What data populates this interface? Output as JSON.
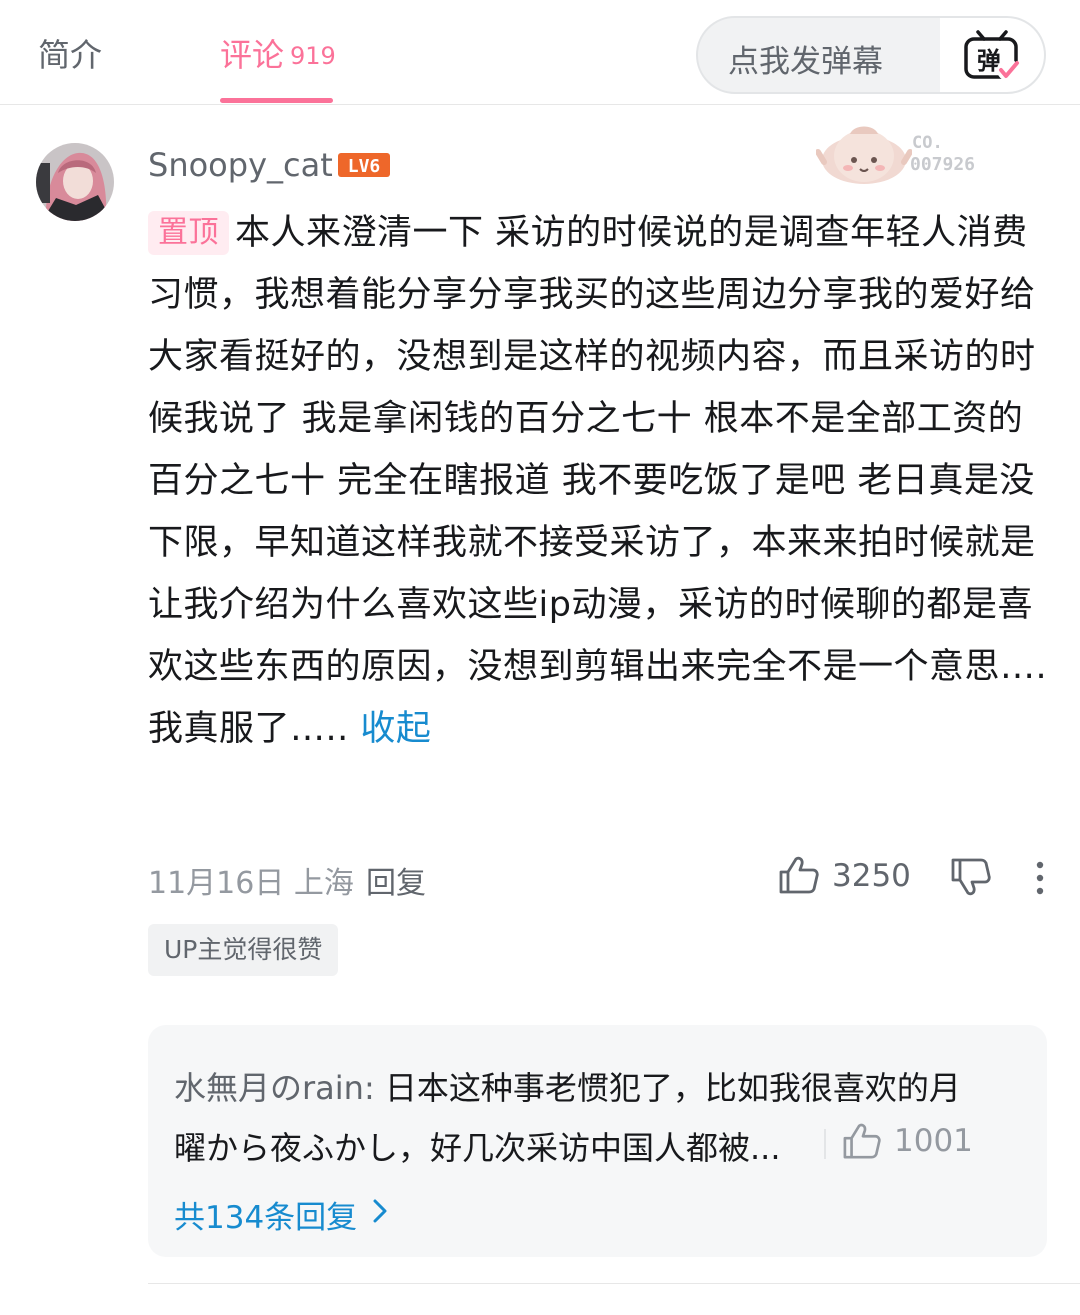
{
  "header": {
    "tab_intro": "简介",
    "tab_comments": "评论",
    "comment_count": "919",
    "danmaku_placeholder": "点我发弹幕",
    "danmaku_toggle_glyph": "弹",
    "accent_color": "#fb7299"
  },
  "comment": {
    "username": "Snoopy_cat",
    "level": "LV6",
    "fan_badge_number": "CO.\n007926",
    "pin_label": "置顶",
    "text": "本人来澄清一下 采访的时候说的是调查年轻人消费习惯，我想着能分享分享我买的这些周边分享我的爱好给大家看挺好的，没想到是这样的视频内容，而且采访的时候我说了 我是拿闲钱的百分之七十 根本不是全部工资的百分之七十 完全在瞎报道 我不要吃饭了是吧 老日真是没下限，早知道这样我就不接受采访了，本来来拍时候就是让我介绍为什么喜欢这些ip动漫，采访的时候聊的都是喜欢这些东西的原因，没想到剪辑出来完全不是一个意思….我真服了…..",
    "collapse_label": "收起",
    "date": "11月16日",
    "location": "上海",
    "reply_label": "回复",
    "like_count": "3250",
    "up_badge": "UP主觉得很赞",
    "icons": [
      "like-icon",
      "dislike-icon",
      "more-vertical-icon"
    ]
  },
  "reply_preview": {
    "username": "水無月のrain:",
    "text_line1": " 日本这种事老惯犯了，比如我很喜欢的月",
    "text_line2": "曜から夜ふかし，好几次采访中国人都被...",
    "like_count": "1001",
    "total_replies": "共134条回复",
    "link_color": "#178bcf"
  }
}
